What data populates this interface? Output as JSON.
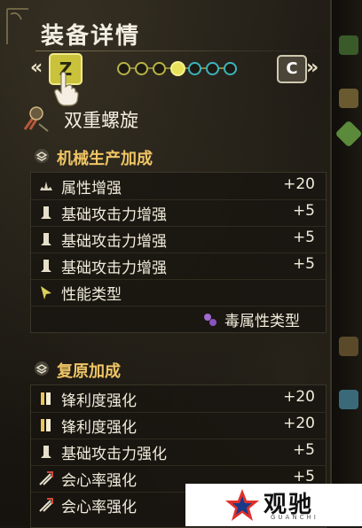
{
  "header": {
    "title": "装备详情",
    "left_arrow": "«",
    "right_arrow": "»",
    "prev_key": "Z",
    "next_key": "C",
    "page_dots_total": 7,
    "page_dot_active_index": 3
  },
  "weapon": {
    "name": "双重螺旋"
  },
  "sections": [
    {
      "title": "机械生产加成",
      "rows": [
        {
          "icon": "element-icon",
          "label": "属性增强",
          "value": "+20"
        },
        {
          "icon": "attack-icon",
          "label": "基础攻击力增强",
          "value": "+5"
        },
        {
          "icon": "attack-icon",
          "label": "基础攻击力增强",
          "value": "+5"
        },
        {
          "icon": "attack-icon",
          "label": "基础攻击力增强",
          "value": "+5"
        },
        {
          "icon": "element-type-icon",
          "label": "性能类型",
          "value": ""
        },
        {
          "icon": "poison-icon",
          "label": "毒属性类型",
          "value": ""
        }
      ]
    },
    {
      "title": "复原加成",
      "rows": [
        {
          "icon": "sharpness-icon",
          "label": "锋利度强化",
          "value": "+20"
        },
        {
          "icon": "sharpness-icon",
          "label": "锋利度强化",
          "value": "+20"
        },
        {
          "icon": "attack-icon",
          "label": "基础攻击力强化",
          "value": "+5"
        },
        {
          "icon": "affinity-icon",
          "label": "会心率强化",
          "value": "+5"
        },
        {
          "icon": "affinity-icon",
          "label": "会心率强化",
          "value": "+5"
        }
      ]
    }
  ],
  "watermark": {
    "text": "观驰",
    "sub": "GUANCHI"
  },
  "colors": {
    "section_title": "#efc465",
    "key_active": "#c9c23a",
    "dot_active": "#e7e25a",
    "dot_teal": "#3bb4bc"
  }
}
